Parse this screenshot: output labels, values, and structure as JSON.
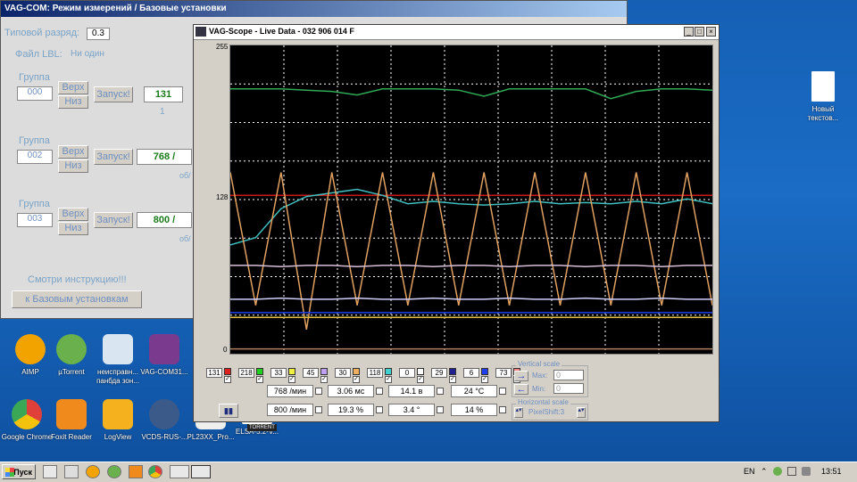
{
  "vagcom": {
    "title": "VAG-COM: Режим измерений  / Базовые установки",
    "tip_label": "Типовой разряд:",
    "tip_value": "0.3",
    "lbl_label": "Файл LBL:",
    "lbl_value": "Ни один",
    "groups": [
      {
        "label": "Группа",
        "number": "000",
        "up": "Верх",
        "down": "Низ",
        "start": "Запуск!",
        "value": "131",
        "sub": "1"
      },
      {
        "label": "Группа",
        "number": "002",
        "up": "Верх",
        "down": "Низ",
        "start": "Запуск!",
        "value": "768 /",
        "sub": "об/"
      },
      {
        "label": "Группа",
        "number": "003",
        "up": "Верх",
        "down": "Низ",
        "start": "Запуск!",
        "value": "800 /",
        "sub": "об/"
      }
    ],
    "instruction": "Смотри инструкцию!!!",
    "basic_button": "к Базовым установкам"
  },
  "desktop_icons": [
    {
      "label": "AIMP",
      "color": "#f2a300"
    },
    {
      "label": "µTorrent",
      "color": "#6ab04c"
    },
    {
      "label": "неисправн... панбда зон...",
      "color": "#d9e6f2"
    },
    {
      "label": "VAG-COM31...",
      "color": "#7a3b8f"
    },
    {
      "label": "Google Chrome",
      "color": "#e0403a"
    },
    {
      "label": "Foxit Reader",
      "color": "#f08a1c"
    },
    {
      "label": "LogView",
      "color": "#f5b21e"
    },
    {
      "label": "VCDS-RUS-...",
      "color": "#3b5a8a"
    },
    {
      "label": "PL23XX_Pro...",
      "color": "#eeeeee"
    },
    {
      "label": "ELSA-5.2-V...",
      "color": "#222222"
    },
    {
      "label": "Новый текстов...",
      "color": "#ffffff"
    }
  ],
  "torrent_badge": "TORRENT",
  "scope": {
    "title": "VAG-Scope - Live Data - 032 906 014 F",
    "y_max": "255",
    "y_mid": "128",
    "y_min": "0",
    "channels": [
      {
        "value": "131",
        "color": "#e02020"
      },
      {
        "value": "218",
        "color": "#20d020"
      },
      {
        "value": "33",
        "color": "#f0f040"
      },
      {
        "value": "45",
        "color": "#c0a0f0"
      },
      {
        "value": "30",
        "color": "#f0b060"
      },
      {
        "value": "118",
        "color": "#40d0d0"
      },
      {
        "value": "0",
        "color": "#ffffff"
      },
      {
        "value": "29",
        "color": "#202090"
      },
      {
        "value": "6",
        "color": "#2040f0"
      },
      {
        "value": "73",
        "color": "#f08080"
      }
    ],
    "readouts_row1": [
      "768 /мин",
      "3.06 мс",
      "14.1 в",
      "24 °C"
    ],
    "readouts_row2": [
      "800 /мин",
      "19.3 %",
      "3.4 °",
      "14 %"
    ],
    "vertical_scale": {
      "title": "Vertical scale",
      "max_label": "Max:",
      "max_value": "0",
      "min_label": "Min:",
      "min_value": "0"
    },
    "horizontal_scale": {
      "title": "Horizontal scale",
      "pixelshift": "PixelShift:3"
    },
    "pause_icon": "pause-icon"
  },
  "chart_data": {
    "type": "line",
    "ylim": [
      0,
      255
    ],
    "yticks": [
      "0",
      "128",
      "255"
    ],
    "series": [
      {
        "color": "#2faa55",
        "values": [
          219,
          219,
          219,
          218,
          217,
          214,
          219,
          219,
          219,
          218,
          213,
          219,
          219,
          219,
          219,
          211,
          217,
          219,
          219,
          218
        ]
      },
      {
        "color": "#c81818",
        "values": [
          131,
          131,
          131,
          131,
          131,
          131,
          131,
          131,
          131,
          131,
          131,
          131,
          131,
          131,
          131,
          131,
          131,
          131,
          131,
          131
        ]
      },
      {
        "color": "#3fbfbf",
        "values": [
          90,
          96,
          120,
          130,
          133,
          136,
          131,
          124,
          126,
          124,
          123,
          124,
          126,
          124,
          125,
          124,
          126,
          124,
          128,
          124
        ]
      },
      {
        "color": "#e0a060",
        "values": [
          150,
          40,
          150,
          20,
          150,
          40,
          150,
          40,
          150,
          40,
          150,
          40,
          150,
          40,
          150,
          40,
          150,
          40,
          150,
          40
        ]
      },
      {
        "color": "#d8c0d8",
        "values": [
          73,
          73,
          72,
          73,
          73,
          72,
          73,
          73,
          72,
          73,
          73,
          72,
          73,
          73,
          72,
          73,
          73,
          72,
          73,
          73
        ]
      },
      {
        "color": "#d0d0ff",
        "values": [
          45,
          45,
          46,
          45,
          45,
          46,
          45,
          45,
          46,
          45,
          45,
          46,
          45,
          45,
          46,
          45,
          45,
          46,
          45,
          45
        ]
      },
      {
        "color": "#2040f0",
        "values": [
          34,
          34,
          34,
          34,
          34,
          34,
          34,
          34,
          34,
          34,
          34,
          34,
          34,
          34,
          34,
          34,
          34,
          34,
          34,
          34
        ]
      },
      {
        "color": "#e0c040",
        "values": [
          30,
          30,
          30,
          30,
          30,
          30,
          30,
          30,
          30,
          30,
          30,
          30,
          30,
          30,
          30,
          30,
          30,
          30,
          30,
          30
        ]
      },
      {
        "color": "#b08060",
        "values": [
          4,
          4,
          4,
          4,
          4,
          4,
          4,
          4,
          4,
          4,
          4,
          4,
          4,
          4,
          4,
          4,
          4,
          4,
          4,
          4
        ]
      }
    ]
  },
  "taskbar": {
    "start": "Пуск",
    "lang": "EN",
    "clock": "13:51"
  }
}
